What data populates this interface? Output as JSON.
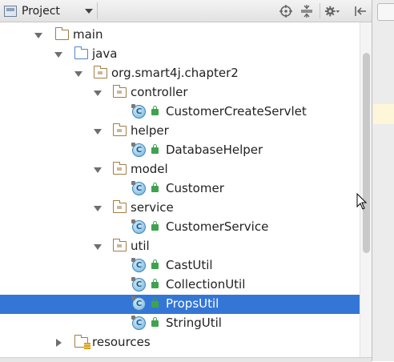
{
  "toolbar": {
    "project_label": "Project",
    "icons": [
      "project-view-icon",
      "locate-target-icon",
      "collapse-all-icon",
      "settings-gear-icon",
      "hide-panel-icon"
    ]
  },
  "tree": {
    "main": "main",
    "java": "java",
    "package": "org.smart4j.chapter2",
    "controller": "controller",
    "CustomerCreateServlet": "CustomerCreateServlet",
    "helper": "helper",
    "DatabaseHelper": "DatabaseHelper",
    "model": "model",
    "Customer": "Customer",
    "service": "service",
    "CustomerService": "CustomerService",
    "util": "util",
    "CastUtil": "CastUtil",
    "CollectionUtil": "CollectionUtil",
    "PropsUtil": "PropsUtil",
    "StringUtil": "StringUtil",
    "resources": "resources",
    "class_glyph": "C",
    "selected": "PropsUtil"
  },
  "colors": {
    "selection": "#3476d6",
    "folder": "#a27c45",
    "source_folder": "#4f86c0",
    "class_icon": "#6fb1dc",
    "access_lock": "#3fa34d"
  }
}
